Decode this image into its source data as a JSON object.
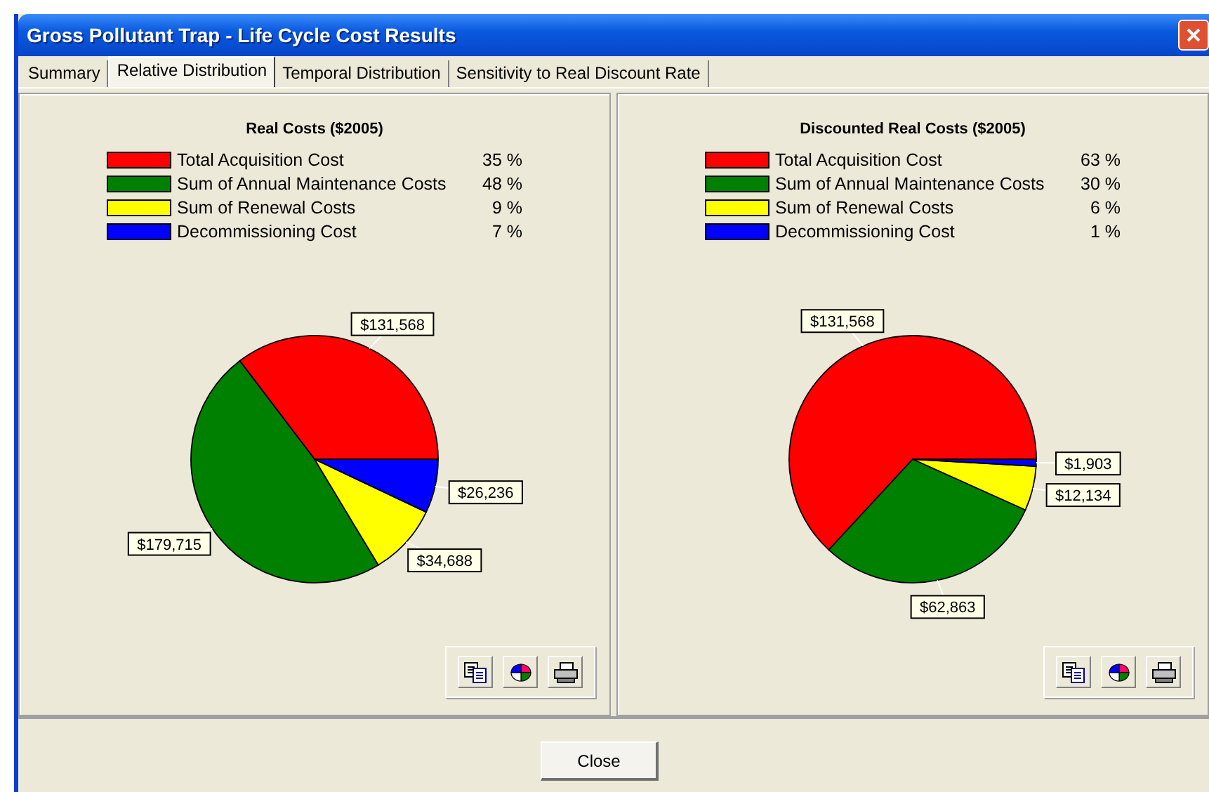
{
  "window": {
    "title": "Gross Pollutant Trap - Life Cycle Cost Results",
    "has_close": true
  },
  "tabs": [
    {
      "label": "Summary",
      "selected": false
    },
    {
      "label": "Relative Distribution",
      "selected": true
    },
    {
      "label": "Temporal Distribution",
      "selected": false
    },
    {
      "label": "Sensitivity to Real Discount Rate",
      "selected": false
    }
  ],
  "panels": [
    {
      "title": "Real Costs ($2005)",
      "legend": [
        {
          "percent": "35 %",
          "color": "#ff0000"
        },
        {
          "percent": "48 %",
          "color": "#008000"
        },
        {
          "percent": "9 %",
          "color": "#ffff00"
        },
        {
          "percent": "7 %",
          "color": "#0000ff"
        }
      ],
      "chart_data": {
        "type": "pie",
        "categories": [
          "Total Acquisition Cost",
          "Sum of Annual Maintenance Costs",
          "Sum of Renewal Costs",
          "Decommissioning Cost"
        ],
        "values": [
          131568,
          179715,
          34688,
          26236
        ],
        "value_labels": [
          "$131,568",
          "$179,715",
          "$34,688",
          "$26,236"
        ]
      }
    },
    {
      "title": "Discounted Real Costs ($2005)",
      "legend": [
        {
          "percent": "63 %",
          "color": "#ff0000"
        },
        {
          "percent": "30 %",
          "color": "#008000"
        },
        {
          "percent": "6 %",
          "color": "#ffff00"
        },
        {
          "percent": "1 %",
          "color": "#0000ff"
        }
      ],
      "chart_data": {
        "type": "pie",
        "categories": [
          "Total Acquisition Cost",
          "Sum of Annual Maintenance Costs",
          "Sum of Renewal Costs",
          "Decommissioning Cost"
        ],
        "values": [
          131568,
          62863,
          12134,
          1903
        ],
        "value_labels": [
          "$131,568",
          "$62,863",
          "$12,134",
          "$1,903"
        ]
      }
    }
  ],
  "close_button": "Close"
}
